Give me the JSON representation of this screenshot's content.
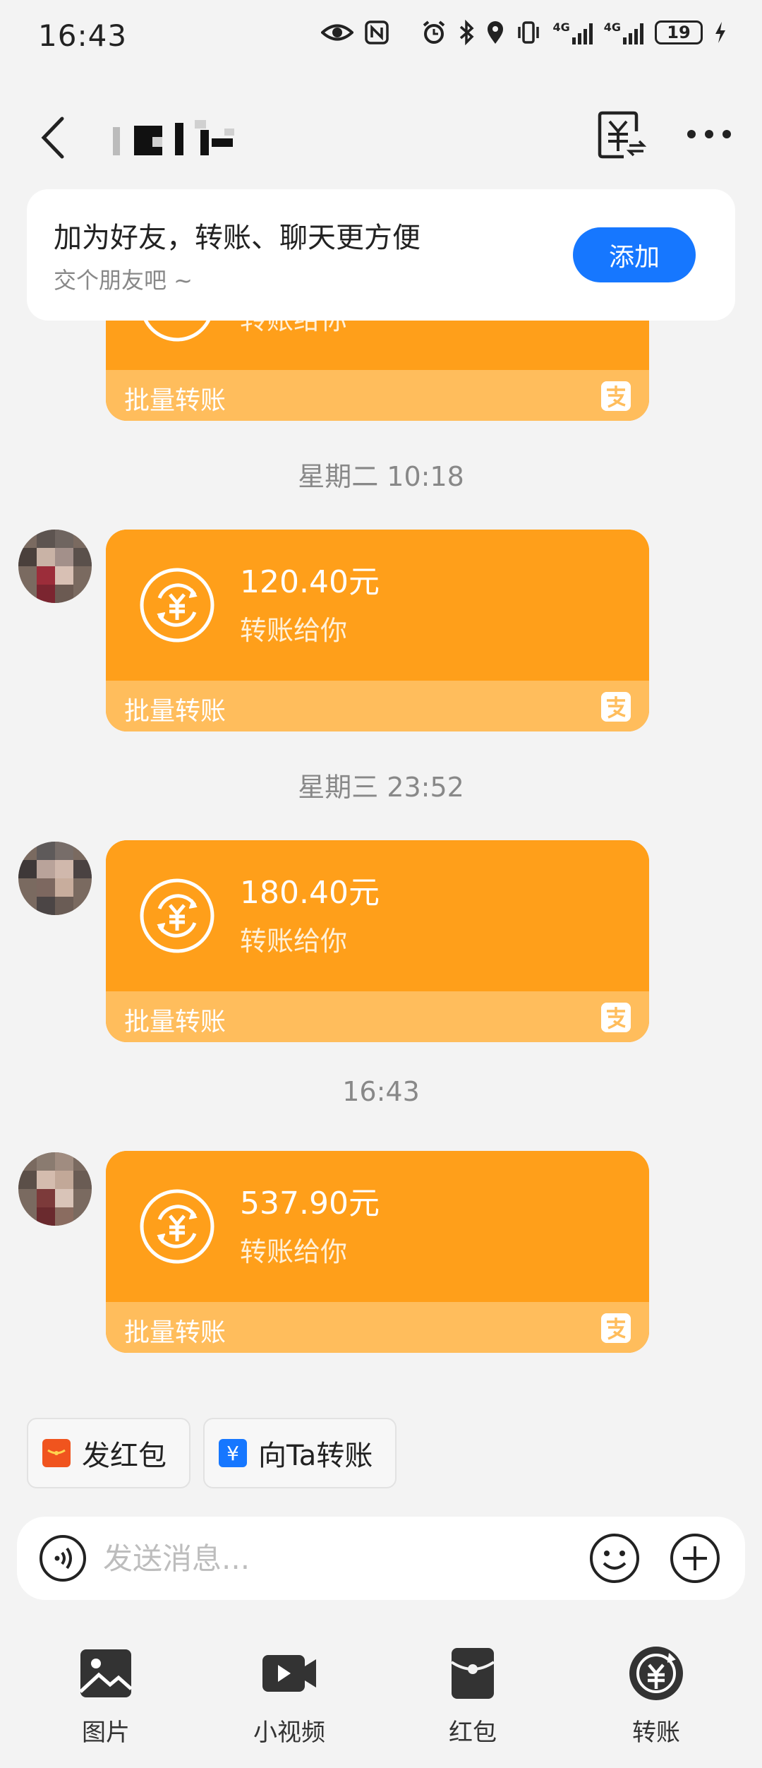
{
  "status_bar": {
    "time": "16:43",
    "battery": "19",
    "network1": "4G",
    "network2": "4G"
  },
  "header": {
    "title": ""
  },
  "friend_banner": {
    "title": "加为好友，转账、聊天更方便",
    "subtitle": "交个朋友吧 ~",
    "add_label": "添加"
  },
  "messages": [
    {
      "partial": true,
      "desc": "转账给你",
      "footer": "批量转账"
    },
    {
      "time": "星期二 10:18",
      "amount": "120.40元",
      "desc": "转账给你",
      "footer": "批量转账"
    },
    {
      "time": "星期三 23:52",
      "amount": "180.40元",
      "desc": "转账给你",
      "footer": "批量转账"
    },
    {
      "time": "16:43",
      "amount": "537.90元",
      "desc": "转账给你",
      "footer": "批量转账"
    }
  ],
  "quick_actions": [
    {
      "label": "发红包",
      "icon": "red-packet-icon",
      "color": "#f0541e"
    },
    {
      "label": "向Ta转账",
      "icon": "yuan-icon",
      "color": "#1677ff"
    }
  ],
  "input": {
    "placeholder": "发送消息..."
  },
  "toolbar": [
    {
      "label": "图片",
      "icon": "image-icon"
    },
    {
      "label": "小视频",
      "icon": "video-icon"
    },
    {
      "label": "红包",
      "icon": "red-packet-icon"
    },
    {
      "label": "转账",
      "icon": "transfer-icon"
    }
  ],
  "colors": {
    "card": "#ff9f1a",
    "card_footer": "#ffbd5c",
    "accent": "#1677ff",
    "background": "#f3f3f3"
  }
}
